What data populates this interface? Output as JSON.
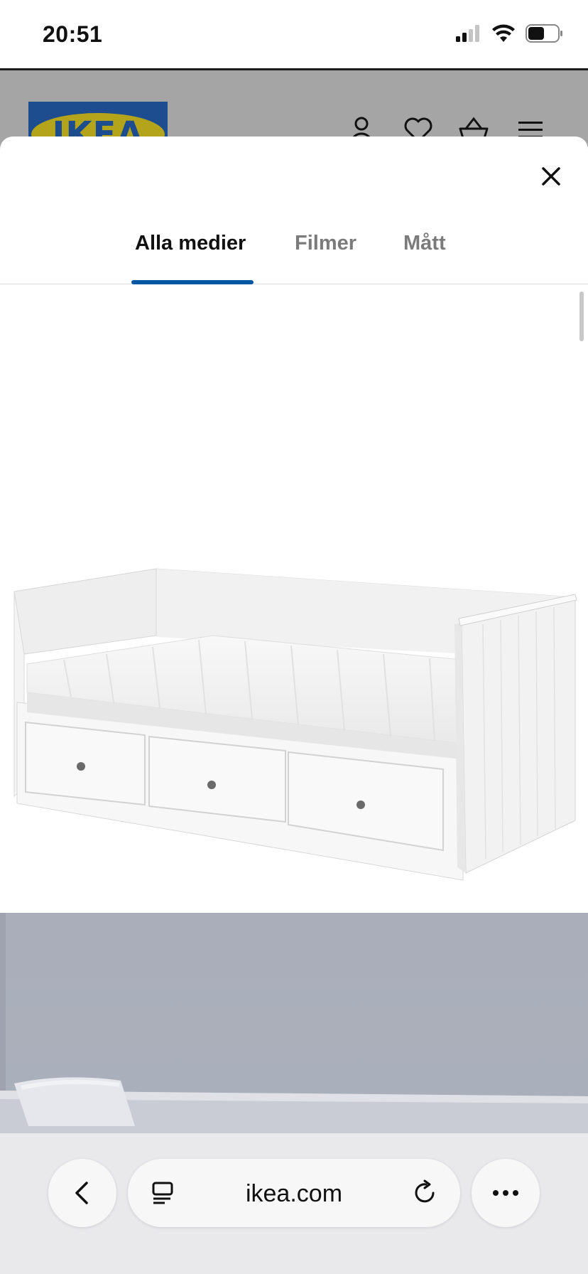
{
  "status": {
    "time": "20:51"
  },
  "site": {
    "logo_text": "IKEA"
  },
  "modal": {
    "tabs": [
      {
        "label": "Alla medier"
      },
      {
        "label": "Filmer"
      },
      {
        "label": "Mått"
      }
    ],
    "active_tab": "Alla medier"
  },
  "browser": {
    "url": "ikea.com"
  },
  "colors": {
    "accent": "#0058a3",
    "ikea_blue": "#1d4d8e",
    "ikea_yellow": "#b3a41b"
  }
}
